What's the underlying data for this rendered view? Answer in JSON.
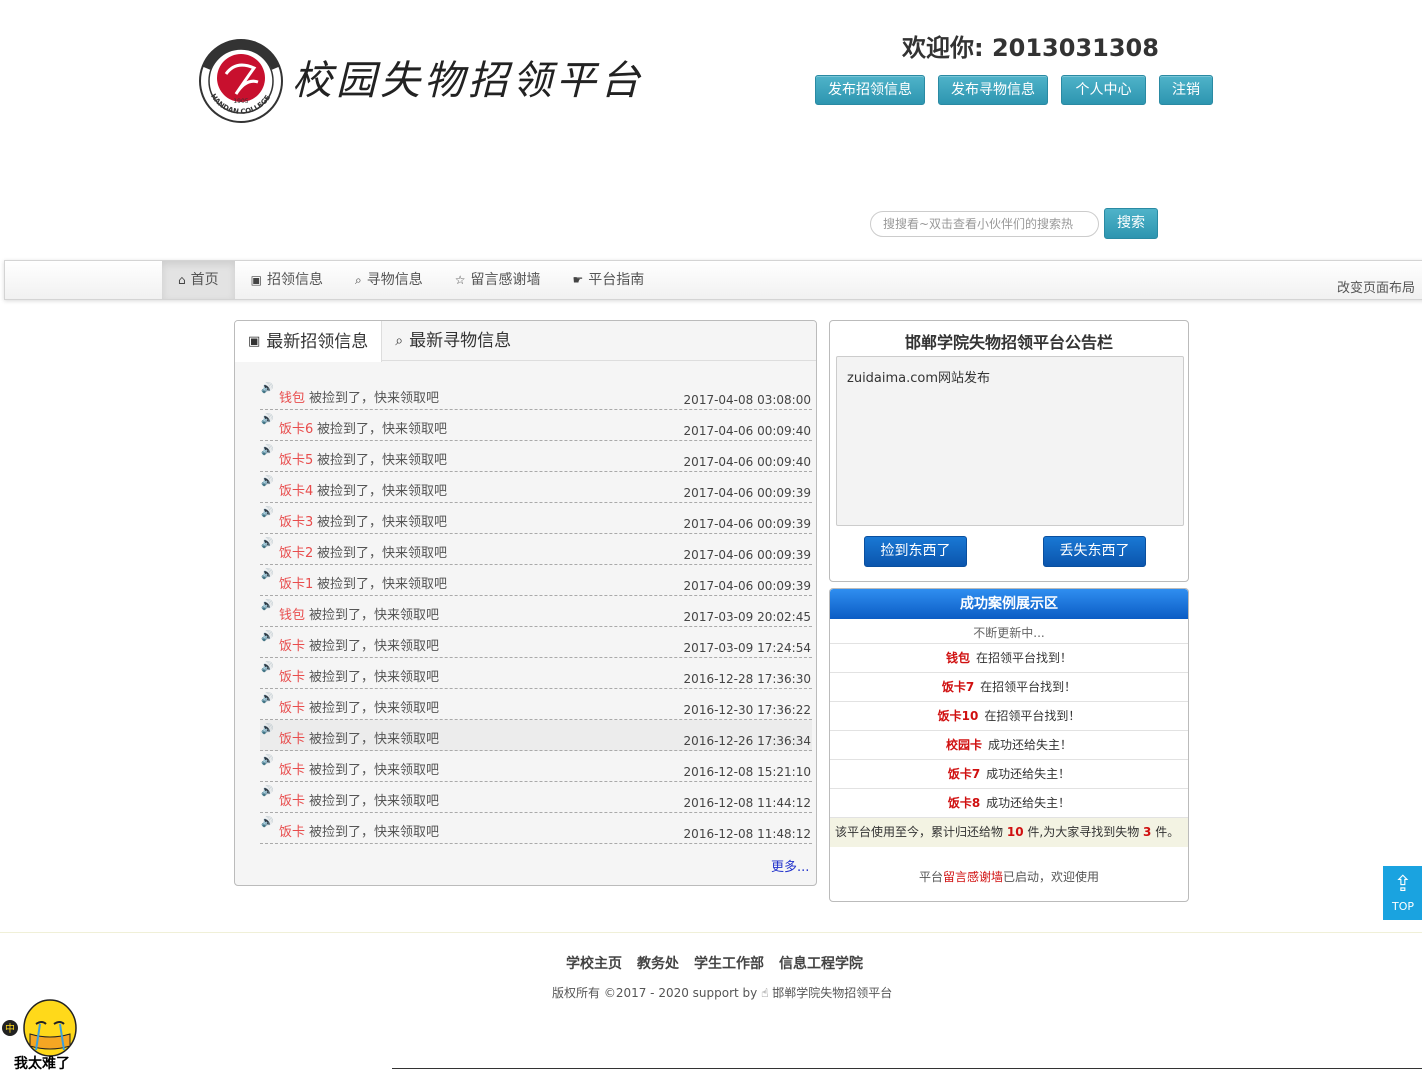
{
  "header": {
    "logo_year": "1905",
    "logo_ring_text": "HANDAN COLLEGE",
    "title": "校园失物招领平台",
    "welcome": "欢迎你: 2013031308",
    "buttons": [
      "发布招领信息",
      "发布寻物信息",
      "个人中心",
      "注销"
    ]
  },
  "search": {
    "placeholder": "搜搜看~双击查看小伙伴们的搜索热",
    "button": "搜索"
  },
  "nav": {
    "items": [
      {
        "label": "首页",
        "icon": "home-icon"
      },
      {
        "label": "招领信息",
        "icon": "picture-icon"
      },
      {
        "label": "寻物信息",
        "icon": "zoom-icon"
      },
      {
        "label": "留言感谢墙",
        "icon": "star-icon"
      },
      {
        "label": "平台指南",
        "icon": "hand-pointer-icon"
      }
    ],
    "layout_link": "改变页面布局"
  },
  "left_panel": {
    "tabs": [
      "最新招领信息",
      "最新寻物信息"
    ],
    "suffix": "被捡到了，快来领取吧",
    "items": [
      {
        "name": "钱包",
        "date": "2017-04-08 03:08:00"
      },
      {
        "name": "饭卡6",
        "date": "2017-04-06 00:09:40"
      },
      {
        "name": "饭卡5",
        "date": "2017-04-06 00:09:40"
      },
      {
        "name": "饭卡4",
        "date": "2017-04-06 00:09:39"
      },
      {
        "name": "饭卡3",
        "date": "2017-04-06 00:09:39"
      },
      {
        "name": "饭卡2",
        "date": "2017-04-06 00:09:39"
      },
      {
        "name": "饭卡1",
        "date": "2017-04-06 00:09:39"
      },
      {
        "name": "钱包",
        "date": "2017-03-09 20:02:45"
      },
      {
        "name": "饭卡",
        "date": "2017-03-09 17:24:54"
      },
      {
        "name": "饭卡",
        "date": "2016-12-28 17:36:30"
      },
      {
        "name": "饭卡",
        "date": "2016-12-30 17:36:22"
      },
      {
        "name": "饭卡",
        "date": "2016-12-26 17:36:34"
      },
      {
        "name": "饭卡",
        "date": "2016-12-08 15:21:10"
      },
      {
        "name": "饭卡",
        "date": "2016-12-08 11:44:12"
      },
      {
        "name": "饭卡",
        "date": "2016-12-08 11:48:12"
      }
    ],
    "more": "更多..."
  },
  "notice": {
    "title": "邯郸学院失物招领平台公告栏",
    "body": "zuidaima.com网站发布",
    "found_btn": "捡到东西了",
    "lost_btn": "丢失东西了"
  },
  "cases": {
    "title": "成功案例展示区",
    "subtitle": "不断更新中...",
    "rows": [
      {
        "item": "钱包",
        "text": "在招领平台找到！"
      },
      {
        "item": "饭卡7",
        "text": "在招领平台找到！"
      },
      {
        "item": "饭卡10",
        "text": "在招领平台找到！"
      },
      {
        "item": "校园卡",
        "text": "成功还给失主！"
      },
      {
        "item": "饭卡7",
        "text": "成功还给失主！"
      },
      {
        "item": "饭卡8",
        "text": "成功还给失主！"
      }
    ],
    "stats": {
      "prefix": "该平台使用至今，累计归还给物",
      "returned": "10",
      "mid": "件,为大家寻找到失物",
      "found": "3",
      "suffix": "件。"
    },
    "guest": {
      "prefix": "平台",
      "link": "留言感谢墙",
      "suffix": "已启动，欢迎使用"
    }
  },
  "top_button": "TOP",
  "footer": {
    "links": [
      "学校主页",
      "教务处",
      "学生工作部",
      "信息工程学院"
    ],
    "copyright_pre": "版权所有 ©2017 - 2020 support by",
    "copyright_post": "邯郸学院失物招领平台"
  },
  "mascot": {
    "badge": "中",
    "caption": "我太难了"
  },
  "colors": {
    "accent": "#2d95b0",
    "primary_blue": "#0b55ad",
    "red": "#d01010",
    "link_red": "#e84c4c"
  }
}
